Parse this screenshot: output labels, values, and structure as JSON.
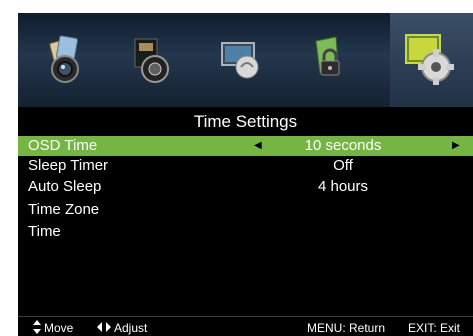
{
  "menu": {
    "icons": [
      "picture-icon",
      "sound-icon",
      "channel-icon",
      "lock-icon",
      "setup-gear-icon"
    ],
    "title": "Time Settings",
    "rows": [
      {
        "label": "OSD Time",
        "value": "10 seconds"
      },
      {
        "label": "Sleep Timer",
        "value": "Off"
      },
      {
        "label": "Auto Sleep",
        "value": "4 hours"
      },
      {
        "label": "Time Zone",
        "value": ""
      },
      {
        "label": "Time",
        "value": ""
      }
    ]
  },
  "footer": {
    "move": "Move",
    "adjust": "Adjust",
    "return": "MENU: Return",
    "exit": "EXIT: Exit"
  },
  "colors": {
    "selected": "#74b543",
    "background": "#000000",
    "icon_bar": "#24374e"
  }
}
